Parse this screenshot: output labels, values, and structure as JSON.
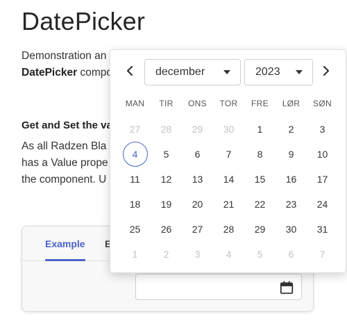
{
  "page": {
    "title": "DatePicker",
    "intro_line1": "Demonstration an",
    "intro_bold": "DatePicker",
    "intro_line2_rest": " compo",
    "section_heading": "Get and Set the va",
    "section_lines": [
      "As all Radzen Bla",
      "has a Value prope",
      "the component. U"
    ]
  },
  "example_card": {
    "tabs": [
      {
        "label": "Example",
        "active": true
      },
      {
        "label": "E",
        "active": false
      }
    ],
    "input": {
      "value": "",
      "calendar_icon": "calendar-icon"
    }
  },
  "calendar": {
    "month": "december",
    "year": "2023",
    "prev_icon": "chevron-left-icon",
    "next_icon": "chevron-right-icon",
    "weekdays": [
      "MAN",
      "TIR",
      "ONS",
      "TOR",
      "FRE",
      "LØR",
      "SØN"
    ],
    "weeks": [
      [
        {
          "d": "27",
          "m": true
        },
        {
          "d": "28",
          "m": true
        },
        {
          "d": "29",
          "m": true
        },
        {
          "d": "30",
          "m": true
        },
        {
          "d": "1"
        },
        {
          "d": "2"
        },
        {
          "d": "3"
        }
      ],
      [
        {
          "d": "4",
          "s": true
        },
        {
          "d": "5"
        },
        {
          "d": "6"
        },
        {
          "d": "7"
        },
        {
          "d": "8"
        },
        {
          "d": "9"
        },
        {
          "d": "10"
        }
      ],
      [
        {
          "d": "11"
        },
        {
          "d": "12"
        },
        {
          "d": "13"
        },
        {
          "d": "14"
        },
        {
          "d": "15"
        },
        {
          "d": "16"
        },
        {
          "d": "17"
        }
      ],
      [
        {
          "d": "18"
        },
        {
          "d": "19"
        },
        {
          "d": "20"
        },
        {
          "d": "21"
        },
        {
          "d": "22"
        },
        {
          "d": "23"
        },
        {
          "d": "24"
        }
      ],
      [
        {
          "d": "25"
        },
        {
          "d": "26"
        },
        {
          "d": "27"
        },
        {
          "d": "28"
        },
        {
          "d": "29"
        },
        {
          "d": "30"
        },
        {
          "d": "31"
        }
      ],
      [
        {
          "d": "1",
          "m": true
        },
        {
          "d": "2",
          "m": true
        },
        {
          "d": "3",
          "m": true
        },
        {
          "d": "4",
          "m": true
        },
        {
          "d": "5",
          "m": true
        },
        {
          "d": "6",
          "m": true
        },
        {
          "d": "7",
          "m": true
        }
      ]
    ],
    "selected_day": "4",
    "accent_color": "#4a64c9"
  }
}
